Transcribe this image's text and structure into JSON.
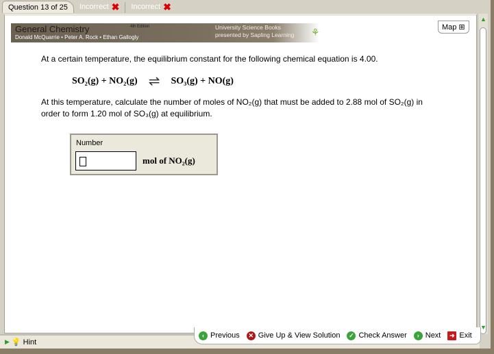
{
  "tabs": {
    "current": "Question 13 of 25",
    "attempts": [
      "Incorrect",
      "Incorrect"
    ]
  },
  "banner": {
    "title": "General Chemistry",
    "edition": "4th Edition",
    "authors": "Donald McQuarrie • Peter A. Rock • Ethan Gallogly",
    "publisher_line1": "University Science Books",
    "publisher_line2": "presented by Sapling Learning"
  },
  "map_label": "Map",
  "question": {
    "intro": "At a certain temperature, the equilibrium constant for the following chemical equation is 4.00.",
    "eq_left": "SO₂(g) + NO₂(g)",
    "eq_right": "SO₃(g) + NO(g)",
    "body_line1": "At this temperature, calculate the number of moles of NO₂(g) that must be added to 2.88 mol of SO₂(g) in",
    "body_line2": "order to form 1.20 mol of SO₃(g) at equilibrium."
  },
  "answer": {
    "label": "Number",
    "value": "",
    "unit": "mol of NO₂(g)"
  },
  "hint_label": "Hint",
  "nav": {
    "previous": "Previous",
    "give_up": "Give Up & View Solution",
    "check": "Check Answer",
    "next": "Next",
    "exit": "Exit"
  }
}
